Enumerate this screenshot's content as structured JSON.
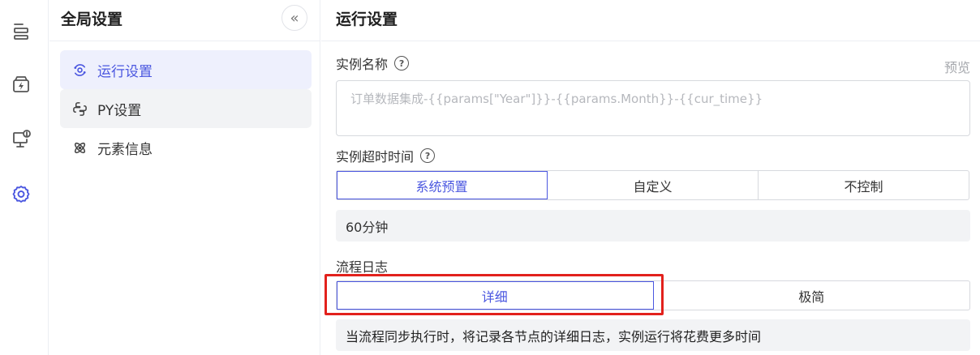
{
  "rail": {
    "items": [
      {
        "icon": "layers-icon"
      },
      {
        "icon": "flash-box-icon"
      },
      {
        "icon": "monitor-alert-icon"
      },
      {
        "icon": "gear-icon",
        "active": true
      }
    ],
    "accent_color": "#4b57e0"
  },
  "sidebar": {
    "title": "全局设置",
    "collapse_glyph": "«",
    "items": [
      {
        "label": "运行设置",
        "icon": "run-settings-icon",
        "state": "active"
      },
      {
        "label": "PY设置",
        "icon": "python-icon",
        "state": "hovered"
      },
      {
        "label": "元素信息",
        "icon": "element-info-icon",
        "state": "normal"
      }
    ]
  },
  "main": {
    "title": "运行设置",
    "instance_name": {
      "label": "实例名称",
      "preview_label": "预览",
      "placeholder": "订单数据集成-{{params[\"Year\"]}}-{{params.Month}}-{{cur_time}}"
    },
    "timeout": {
      "label": "实例超时时间",
      "options": [
        "系统预置",
        "自定义",
        "不控制"
      ],
      "selected_index": 0,
      "value": "60分钟"
    },
    "flow_log": {
      "label": "流程日志",
      "options": [
        "详细",
        "极简"
      ],
      "selected_index": 0,
      "description": "当流程同步执行时，将记录各节点的详细日志，实例运行将花费更多时间"
    }
  }
}
